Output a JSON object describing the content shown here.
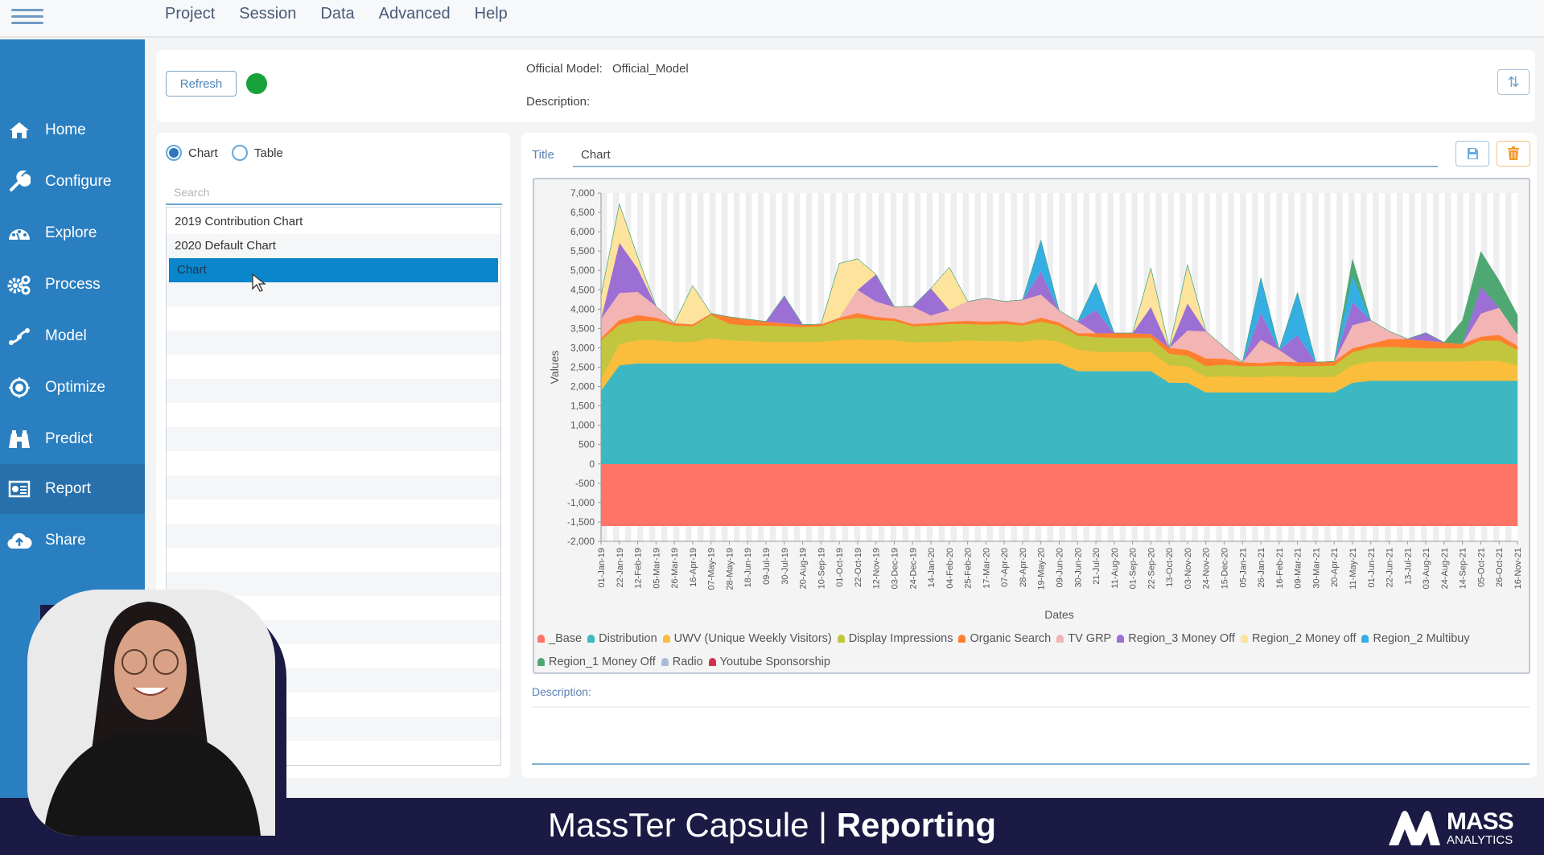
{
  "menu": {
    "items": [
      "Project",
      "Session",
      "Data",
      "Advanced",
      "Help"
    ]
  },
  "sidebar": {
    "items": [
      {
        "label": "Home",
        "icon": "home-icon"
      },
      {
        "label": "Configure",
        "icon": "wrench-icon"
      },
      {
        "label": "Explore",
        "icon": "gauge-icon"
      },
      {
        "label": "Process",
        "icon": "gears-icon"
      },
      {
        "label": "Model",
        "icon": "model-icon"
      },
      {
        "label": "Optimize",
        "icon": "target-icon"
      },
      {
        "label": "Predict",
        "icon": "binoculars-icon"
      },
      {
        "label": "Report",
        "icon": "report-icon"
      },
      {
        "label": "Share",
        "icon": "cloud-upload-icon"
      }
    ],
    "active": "Report"
  },
  "header": {
    "refresh_label": "Refresh",
    "status_color": "#17a13b",
    "official_model_label": "Official Model:",
    "official_model_value": "Official_Model",
    "description_label": "Description:"
  },
  "left_panel": {
    "radio_chart": "Chart",
    "radio_table": "Table",
    "selected_mode": "Chart",
    "search_placeholder": "Search",
    "items": [
      "2019 Contribution Chart",
      "2020 Default Chart",
      "Chart"
    ],
    "selected_item": "Chart"
  },
  "right_panel": {
    "title_label": "Title",
    "title_value": "Chart",
    "description_label": "Description:",
    "description_value": ""
  },
  "footer": {
    "title_light": "MassTer Capsule | ",
    "title_bold": "Reporting",
    "logo_main": "MASS",
    "logo_sub": "ANALYTICS"
  },
  "chart_data": {
    "type": "area",
    "stacked": true,
    "title": "",
    "xlabel": "Dates",
    "ylabel": "Values",
    "ylim": [
      -2000,
      7000
    ],
    "yticks": [
      "-2,000",
      "-1,500",
      "-1,000",
      "-500",
      "0",
      "500",
      "1,000",
      "1,500",
      "2,000",
      "2,500",
      "3,000",
      "3,500",
      "4,000",
      "4,500",
      "5,000",
      "5,500",
      "6,000",
      "6,500",
      "7,000"
    ],
    "ytick_values": [
      -2000,
      -1500,
      -1000,
      -500,
      0,
      500,
      1000,
      1500,
      2000,
      2500,
      3000,
      3500,
      4000,
      4500,
      5000,
      5500,
      6000,
      6500,
      7000
    ],
    "x": [
      "01-Jan-19",
      "22-Jan-19",
      "12-Feb-19",
      "05-Mar-19",
      "26-Mar-19",
      "16-Apr-19",
      "07-May-19",
      "28-May-19",
      "18-Jun-19",
      "09-Jul-19",
      "30-Jul-19",
      "20-Aug-19",
      "10-Sep-19",
      "01-Oct-19",
      "22-Oct-19",
      "12-Nov-19",
      "03-Dec-19",
      "24-Dec-19",
      "14-Jan-20",
      "04-Feb-20",
      "25-Feb-20",
      "17-Mar-20",
      "07-Apr-20",
      "28-Apr-20",
      "19-May-20",
      "09-Jun-20",
      "30-Jun-20",
      "21-Jul-20",
      "11-Aug-20",
      "01-Sep-20",
      "22-Sep-20",
      "13-Oct-20",
      "03-Nov-20",
      "24-Nov-20",
      "15-Dec-20",
      "05-Jan-21",
      "26-Jan-21",
      "16-Feb-21",
      "09-Mar-21",
      "30-Mar-21",
      "20-Apr-21",
      "11-May-21",
      "01-Jun-21",
      "22-Jun-21",
      "13-Jul-21",
      "03-Aug-21",
      "24-Aug-21",
      "14-Sep-21",
      "05-Oct-21",
      "26-Oct-21",
      "16-Nov-21"
    ],
    "legend_position": "bottom",
    "series": [
      {
        "name": "_Base",
        "color": "#ff7467",
        "values": [
          -1600,
          -1600,
          -1600,
          -1600,
          -1600,
          -1600,
          -1600,
          -1600,
          -1600,
          -1600,
          -1600,
          -1600,
          -1600,
          -1600,
          -1600,
          -1600,
          -1600,
          -1600,
          -1600,
          -1600,
          -1600,
          -1600,
          -1600,
          -1600,
          -1600,
          -1600,
          -1600,
          -1600,
          -1600,
          -1600,
          -1600,
          -1600,
          -1600,
          -1600,
          -1600,
          -1600,
          -1600,
          -1600,
          -1600,
          -1600,
          -1600,
          -1600,
          -1600,
          -1600,
          -1600,
          -1600,
          -1600,
          -1600,
          -1600,
          -1600,
          -1600
        ]
      },
      {
        "name": "Distribution",
        "color": "#3db8c2",
        "values": [
          1900,
          2550,
          2600,
          2600,
          2600,
          2600,
          2600,
          2600,
          2600,
          2600,
          2600,
          2600,
          2600,
          2600,
          2600,
          2600,
          2600,
          2600,
          2600,
          2600,
          2600,
          2600,
          2600,
          2600,
          2600,
          2600,
          2400,
          2400,
          2400,
          2400,
          2400,
          2100,
          2100,
          1850,
          1850,
          1850,
          1850,
          1850,
          1850,
          1850,
          1850,
          2100,
          2150,
          2150,
          2150,
          2150,
          2150,
          2150,
          2150,
          2150,
          2150
        ]
      },
      {
        "name": "UWV (Unique Weekly Visitors)",
        "color": "#fbbd3c",
        "values": [
          300,
          550,
          600,
          600,
          560,
          560,
          650,
          600,
          580,
          560,
          560,
          560,
          560,
          600,
          620,
          600,
          600,
          540,
          560,
          560,
          600,
          580,
          580,
          560,
          620,
          560,
          560,
          500,
          500,
          500,
          500,
          450,
          420,
          400,
          420,
          400,
          400,
          420,
          400,
          400,
          400,
          450,
          500,
          500,
          500,
          500,
          500,
          500,
          520,
          520,
          400
        ]
      },
      {
        "name": "Display Impressions",
        "color": "#c2c63e",
        "values": [
          1000,
          500,
          500,
          500,
          420,
          400,
          600,
          420,
          400,
          420,
          400,
          380,
          400,
          520,
          560,
          520,
          500,
          420,
          420,
          460,
          420,
          420,
          440,
          420,
          460,
          420,
          360,
          380,
          360,
          360,
          360,
          300,
          280,
          280,
          300,
          280,
          280,
          280,
          280,
          280,
          300,
          340,
          360,
          380,
          360,
          340,
          340,
          340,
          520,
          520,
          400
        ]
      },
      {
        "name": "Organic Search",
        "color": "#ff7f2e",
        "values": [
          50,
          120,
          150,
          80,
          60,
          50,
          40,
          180,
          160,
          100,
          80,
          60,
          50,
          60,
          120,
          80,
          60,
          60,
          60,
          60,
          80,
          80,
          80,
          60,
          100,
          80,
          60,
          100,
          120,
          120,
          100,
          150,
          150,
          200,
          150,
          100,
          80,
          100,
          100,
          100,
          100,
          100,
          100,
          200,
          220,
          200,
          150,
          120,
          100,
          150,
          100
        ]
      },
      {
        "name": "TV GRP",
        "color": "#f3b4b4",
        "values": [
          500,
          700,
          600,
          300,
          0,
          0,
          0,
          0,
          0,
          0,
          0,
          0,
          0,
          0,
          600,
          400,
          300,
          450,
          200,
          300,
          500,
          600,
          500,
          600,
          600,
          300,
          300,
          0,
          0,
          0,
          0,
          0,
          500,
          700,
          300,
          0,
          600,
          300,
          0,
          0,
          0,
          600,
          600,
          200,
          0,
          0,
          0,
          0,
          600,
          700,
          300
        ]
      },
      {
        "name": "Region_3 Money Off",
        "color": "#9c6fd4",
        "values": [
          0,
          1300,
          600,
          0,
          0,
          0,
          0,
          0,
          0,
          0,
          700,
          0,
          0,
          0,
          0,
          700,
          0,
          0,
          700,
          0,
          0,
          0,
          0,
          0,
          600,
          0,
          0,
          600,
          0,
          0,
          700,
          0,
          700,
          0,
          0,
          0,
          700,
          0,
          700,
          0,
          0,
          600,
          0,
          0,
          0,
          200,
          0,
          0,
          700,
          0,
          0
        ],
        "label_note": ""
      },
      {
        "name": "Region_2 Money off",
        "color": "#fde39b",
        "values": [
          600,
          1000,
          300,
          0,
          0,
          1000,
          0,
          0,
          0,
          0,
          0,
          0,
          0,
          1400,
          800,
          0,
          0,
          0,
          0,
          1100,
          0,
          0,
          0,
          0,
          0,
          0,
          0,
          0,
          0,
          0,
          1000,
          0,
          1000,
          0,
          0,
          0,
          0,
          0,
          0,
          0,
          0,
          0,
          0,
          0,
          0,
          0,
          0,
          0,
          0,
          0,
          0
        ]
      },
      {
        "name": "Region_2 Multibuy",
        "color": "#35aee4",
        "values": [
          0,
          0,
          0,
          0,
          0,
          0,
          0,
          0,
          0,
          0,
          0,
          0,
          0,
          0,
          0,
          0,
          0,
          0,
          0,
          0,
          0,
          0,
          0,
          0,
          800,
          0,
          0,
          700,
          0,
          0,
          0,
          0,
          0,
          0,
          0,
          0,
          900,
          0,
          1100,
          0,
          0,
          700,
          0,
          0,
          0,
          0,
          0,
          0,
          0,
          0,
          0
        ]
      },
      {
        "name": "Region_1 Money Off",
        "color": "#4fa872",
        "values": [
          0,
          0,
          0,
          0,
          0,
          0,
          0,
          0,
          0,
          0,
          0,
          0,
          0,
          0,
          0,
          0,
          0,
          0,
          0,
          0,
          0,
          0,
          0,
          0,
          0,
          0,
          0,
          0,
          0,
          0,
          0,
          0,
          0,
          0,
          0,
          0,
          0,
          0,
          0,
          0,
          0,
          400,
          0,
          0,
          0,
          0,
          0,
          600,
          900,
          700,
          500
        ]
      },
      {
        "name": "Radio",
        "color": "#a9bcd6",
        "values": [
          0,
          0,
          0,
          0,
          0,
          0,
          0,
          0,
          0,
          0,
          0,
          0,
          0,
          0,
          0,
          0,
          0,
          0,
          0,
          0,
          0,
          0,
          0,
          0,
          0,
          0,
          0,
          0,
          0,
          0,
          0,
          0,
          0,
          0,
          0,
          0,
          0,
          0,
          0,
          0,
          0,
          0,
          0,
          0,
          0,
          0,
          0,
          0,
          0,
          0,
          0
        ]
      },
      {
        "name": "Youtube Sponsorship",
        "color": "#d1314f",
        "values": [
          0,
          0,
          0,
          0,
          0,
          0,
          0,
          0,
          0,
          0,
          0,
          0,
          0,
          0,
          0,
          0,
          0,
          0,
          0,
          0,
          0,
          0,
          0,
          0,
          0,
          0,
          0,
          0,
          0,
          0,
          0,
          0,
          0,
          0,
          0,
          0,
          0,
          0,
          0,
          0,
          0,
          0,
          0,
          0,
          0,
          0,
          0,
          0,
          0,
          0,
          0
        ]
      }
    ]
  }
}
